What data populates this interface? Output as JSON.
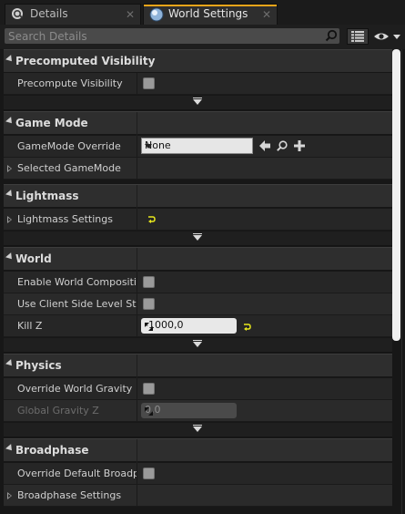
{
  "tabs": [
    {
      "label": "Details",
      "icon": "details-icon",
      "close": "✕"
    },
    {
      "label": "World Settings",
      "icon": "world-icon",
      "close": "✕"
    }
  ],
  "search": {
    "placeholder": "Search Details",
    "value": ""
  },
  "toolbar": {
    "view_options_icon": "grid-icon",
    "visibility_icon": "eye-icon"
  },
  "sections": {
    "precomputed_visibility": {
      "title": "Precomputed Visibility",
      "rows": [
        {
          "label": "Precompute Visibility",
          "checked": false
        }
      ]
    },
    "game_mode": {
      "title": "Game Mode",
      "gamemode_override": {
        "label": "GameMode Override",
        "value": "None"
      },
      "selected_gamemode": {
        "label": "Selected GameMode"
      }
    },
    "lightmass": {
      "title": "Lightmass",
      "lightmass_settings": {
        "label": "Lightmass Settings"
      }
    },
    "world": {
      "title": "World",
      "enable_world_composition": {
        "label": "Enable World Composition",
        "checked": false
      },
      "use_client_side_level_streaming": {
        "label": "Use Client Side Level Streaming",
        "checked": false
      },
      "kill_z": {
        "label": "Kill Z",
        "value": "-1000,0"
      }
    },
    "physics": {
      "title": "Physics",
      "override_world_gravity": {
        "label": "Override World Gravity",
        "checked": false
      },
      "global_gravity_z": {
        "label": "Global Gravity Z",
        "value": "0,0"
      }
    },
    "broadphase": {
      "title": "Broadphase",
      "override_default_broadphase": {
        "label": "Override Default Broadphase Settings",
        "checked": false
      },
      "broadphase_settings": {
        "label": "Broadphase Settings"
      }
    }
  },
  "colors": {
    "accent_tab": "#f1a51a",
    "reset_arrow": "#e8e81c",
    "panel_bg": "#262626"
  }
}
